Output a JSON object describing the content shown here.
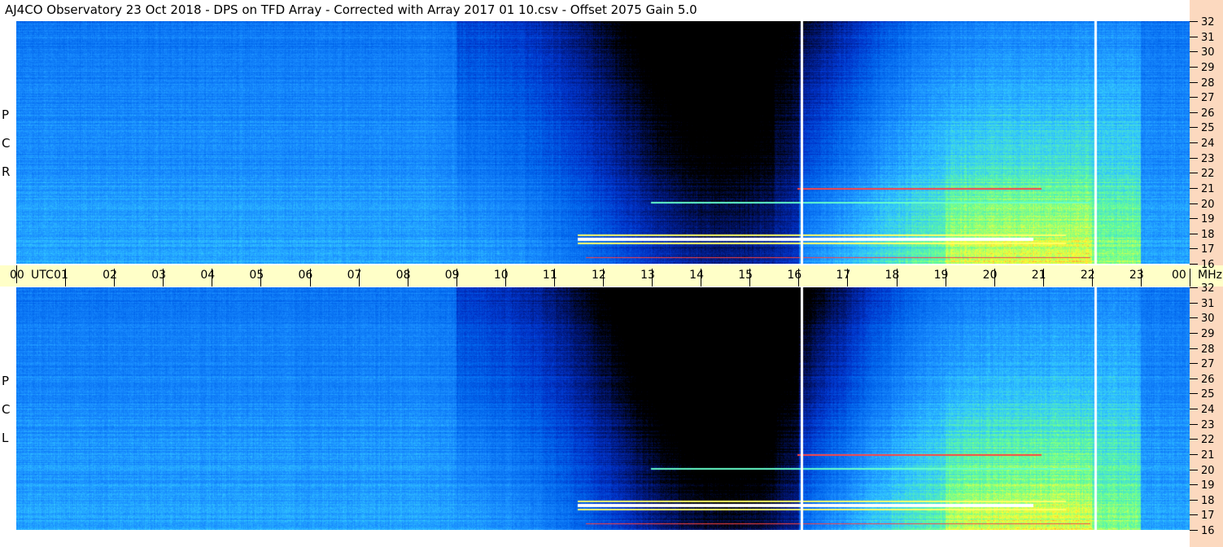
{
  "title": "AJ4CO Observatory  23 Oct 2018  -  DPS on TFD Array  -  Corrected with Array 2017 01 10.csv  -  Offset 2075  Gain 5.0",
  "chart_data": [
    {
      "type": "heatmap",
      "name": "RCP",
      "label_letters": [
        "R",
        "C",
        "P"
      ],
      "x_unit": "UTC",
      "x_ticks": [
        "00",
        "01",
        "02",
        "03",
        "04",
        "05",
        "06",
        "07",
        "08",
        "09",
        "10",
        "11",
        "12",
        "13",
        "14",
        "15",
        "16",
        "17",
        "18",
        "19",
        "20",
        "21",
        "22",
        "23",
        "00"
      ],
      "x_range_hours": [
        0,
        24
      ],
      "y_unit": "MHz",
      "y_ticks": [
        "32",
        "31",
        "30",
        "29",
        "28",
        "27",
        "26",
        "25",
        "24",
        "23",
        "22",
        "21",
        "20",
        "19",
        "18",
        "17",
        "16"
      ],
      "y_range_mhz": [
        16,
        32
      ],
      "colors": [
        "#000000",
        "#001a6e",
        "#0033cc",
        "#0066ee",
        "#1e90ff",
        "#33ccff",
        "#66ff99",
        "#ffff33",
        "#ff3333",
        "#ffffff"
      ],
      "vertical_markers_hours": [
        16.05,
        22.05
      ]
    },
    {
      "type": "heatmap",
      "name": "LCP",
      "label_letters": [
        "L",
        "C",
        "P"
      ],
      "x_unit": "UTC",
      "x_range_hours": [
        0,
        24
      ],
      "y_unit": "MHz",
      "y_ticks": [
        "32",
        "31",
        "30",
        "29",
        "28",
        "27",
        "26",
        "25",
        "24",
        "23",
        "22",
        "21",
        "20",
        "19",
        "18",
        "17",
        "16"
      ],
      "y_range_mhz": [
        16,
        32
      ],
      "vertical_markers_hours": [
        16.05,
        22.05
      ]
    }
  ],
  "time_axis": {
    "labels": [
      "00",
      "01",
      "02",
      "03",
      "04",
      "05",
      "06",
      "07",
      "08",
      "09",
      "10",
      "11",
      "12",
      "13",
      "14",
      "15",
      "16",
      "17",
      "18",
      "19",
      "20",
      "21",
      "22",
      "23",
      "00"
    ],
    "utc_label": "UTC",
    "unit_label": "MHz"
  },
  "colors": {
    "time_band": "#ffffc8",
    "right_strip": "#fcd9bf",
    "background": "#ffffff"
  }
}
